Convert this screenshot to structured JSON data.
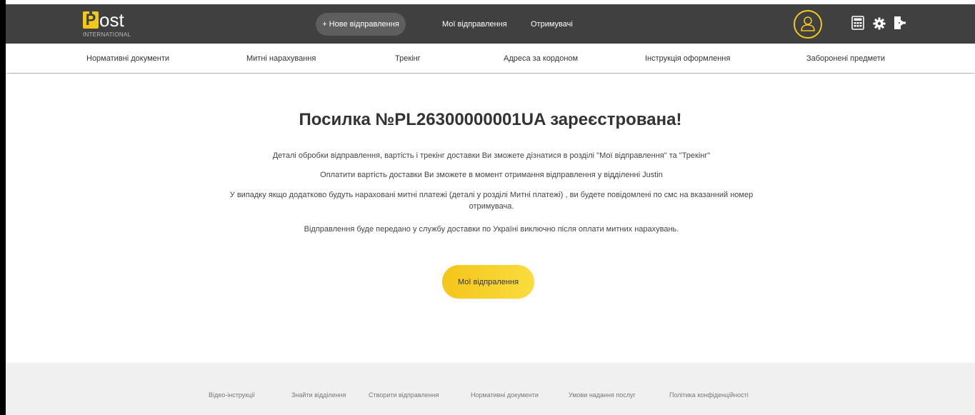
{
  "header": {
    "logo_letter": "P",
    "logo_text": "ost",
    "logo_subtext": "INTERNATIONAL",
    "new_shipment_label": "+ Нове відправлення",
    "my_shipments_label": "Мої відправлення",
    "recipients_label": "Отримувачі",
    "icons": [
      "user-icon",
      "calculator-icon",
      "gear-icon",
      "logout-icon"
    ],
    "accent_color": "#f2c81b",
    "bar_color": "#404040"
  },
  "subnav": {
    "items": [
      "Нормативні документи",
      "Митні нарахування",
      "Трекінг",
      "Адреса за кордоном",
      "Інструкція оформлення",
      "Заборонені предмети"
    ]
  },
  "main": {
    "title": "Посилка №PL26300000001UA зареєстрована!",
    "p1": "Деталі обробки відправлення, вартість і трекінг доставки Ви зможете дізнатися в розділі \"Мої відправлення\" та \"Трекінг\"",
    "p2": "Оплатити вартість доставки Ви зможете в момент отримання відправлення у відділенні Justin",
    "p3": "У випадку якщо додатково будуть нараховані митні платежі (деталі у розділі Митні платежі) , ви будете повідомлені по смс на вказанний номер отримувача.",
    "p4": "Відправлення буде передано у службу доставки по Україні виключно після оплати митних нарахувань.",
    "button_label": "Мої відпралення"
  },
  "footer": {
    "links": [
      "Відео-інструкції",
      "Знайти відділення",
      "Створити відправлення",
      "Нормативні документи",
      "Умови надання послуг",
      "Політика конфіденційності"
    ]
  }
}
